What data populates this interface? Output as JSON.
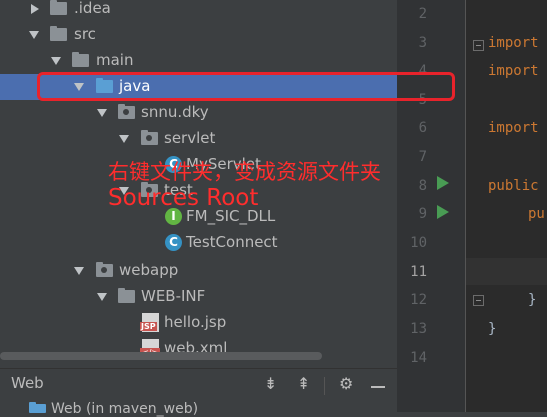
{
  "tree": {
    "items": [
      {
        "label": ".idea"
      },
      {
        "label": "src"
      },
      {
        "label": "main"
      },
      {
        "label": "java"
      },
      {
        "label": "snnu.dky"
      },
      {
        "label": "servlet"
      },
      {
        "label": "MyServlet"
      },
      {
        "label": "test"
      },
      {
        "label": "FM_SIC_DLL"
      },
      {
        "label": "TestConnect"
      },
      {
        "label": "webapp"
      },
      {
        "label": "WEB-INF"
      },
      {
        "label": "hello.jsp"
      },
      {
        "label": "web.xml"
      }
    ]
  },
  "annotation": {
    "chinese": "右键文件夹，变成资源文件夹",
    "english": "Sources Root"
  },
  "editor": {
    "line_numbers": [
      "2",
      "3",
      "4",
      "5",
      "6",
      "7",
      "8",
      "9",
      "10",
      "11",
      "12",
      "13",
      "14"
    ],
    "code": {
      "l3": "import",
      "l4": "import",
      "l6": "import",
      "l8": "public",
      "l9": "pu",
      "l12": "}",
      "l13": "}"
    }
  },
  "bottom_panel": {
    "title": "Web",
    "partial_item": "Web (in maven_web)"
  }
}
